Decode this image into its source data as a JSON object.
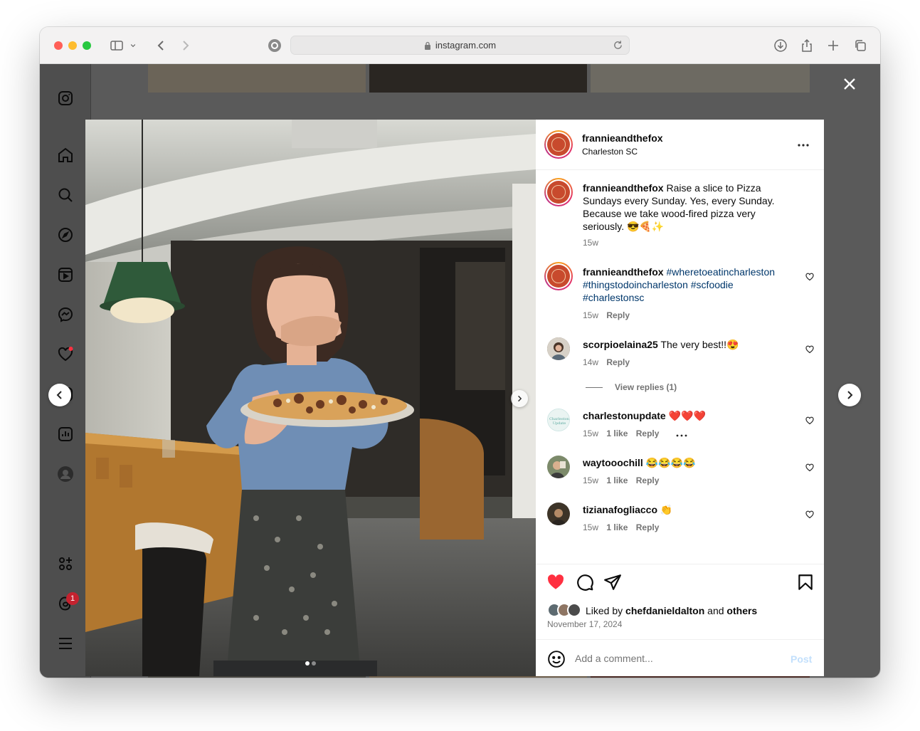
{
  "browser": {
    "url": "instagram.com"
  },
  "post": {
    "author": "frannieandthefox",
    "location": "Charleston SC",
    "caption_user": "frannieandthefox",
    "caption_text": "Raise a slice to Pizza Sundays every Sunday. Yes, every Sunday. Because we take wood-fired pizza very seriously. 😎🍕✨",
    "caption_time": "15w",
    "liked_by_prefix": "Liked by",
    "liked_by_user": "chefdanieldalton",
    "liked_by_and": "and",
    "liked_by_others": "others",
    "date": "November 17, 2024",
    "add_comment_placeholder": "Add a comment...",
    "post_button": "Post"
  },
  "comments": [
    {
      "user": "frannieandthefox",
      "text": "#wheretoeatincharleston #thingstodoincharleston #scfoodie #charlestonsc",
      "time": "15w",
      "likes": "",
      "reply": "Reply"
    },
    {
      "user": "scorpioelaina25",
      "text": "The very best!!😍",
      "time": "14w",
      "likes": "",
      "reply": "Reply",
      "view_replies": "View replies (1)"
    },
    {
      "user": "charlestonupdate",
      "text": "❤️❤️❤️",
      "time": "15w",
      "likes": "1 like",
      "reply": "Reply"
    },
    {
      "user": "waytooochill",
      "text": "😂😂😂😂",
      "time": "15w",
      "likes": "1 like",
      "reply": "Reply"
    },
    {
      "user": "tizianafogliacco",
      "text": "👏",
      "time": "15w",
      "likes": "1 like",
      "reply": "Reply"
    }
  ],
  "sidebar": {
    "notification_count": "1"
  },
  "colors": {
    "like_red": "#ff3040",
    "hashtag_blue": "#00376b",
    "post_button_disabled": "#c3e0fc",
    "overlay": "#5a5a5a"
  },
  "carousel": {
    "current_index": 1,
    "total": 2
  }
}
